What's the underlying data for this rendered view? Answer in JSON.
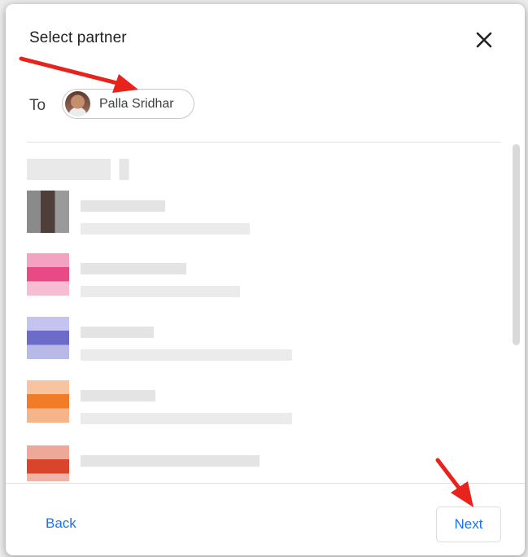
{
  "dialog": {
    "title": "Select partner",
    "close_icon": "close-icon"
  },
  "recipient": {
    "label": "To",
    "chip_name": "Palla Sridhar",
    "avatar_icon": "person-avatar"
  },
  "contacts": {
    "items": [
      {
        "avatar_colors": [
          "#7a7a7a",
          "#5a4a44",
          "#8d8d8d"
        ]
      },
      {
        "avatar_colors": [
          "#e84a86",
          "#f07aa8",
          "#f5b6cc"
        ]
      },
      {
        "avatar_colors": [
          "#6c6cc8",
          "#9b9be0",
          "#c8c8ef"
        ]
      },
      {
        "avatar_colors": [
          "#f07c28",
          "#f5a466",
          "#f9cfae"
        ]
      },
      {
        "avatar_colors": [
          "#d9452a",
          "#e8806c",
          "#f4c0b4"
        ]
      }
    ]
  },
  "footer": {
    "back_label": "Back",
    "next_label": "Next"
  },
  "annotations": {
    "arrow_color": "#e8231c"
  }
}
